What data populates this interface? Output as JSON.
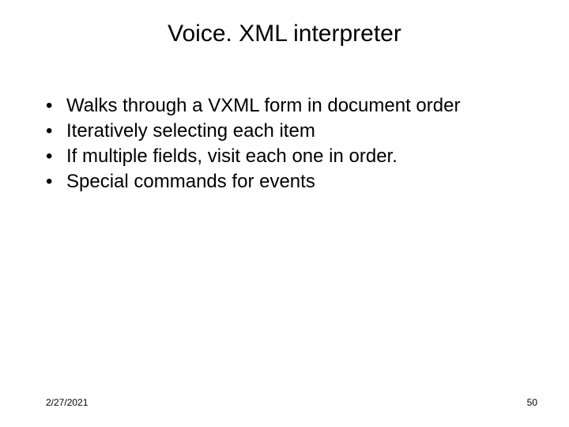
{
  "slide": {
    "title": "Voice. XML interpreter",
    "bullets": [
      "Walks through a VXML form in document order",
      "Iteratively selecting each item",
      "If multiple fields, visit each one in order.",
      "Special commands for events"
    ],
    "footer": {
      "date": "2/27/2021",
      "page": "50"
    }
  }
}
